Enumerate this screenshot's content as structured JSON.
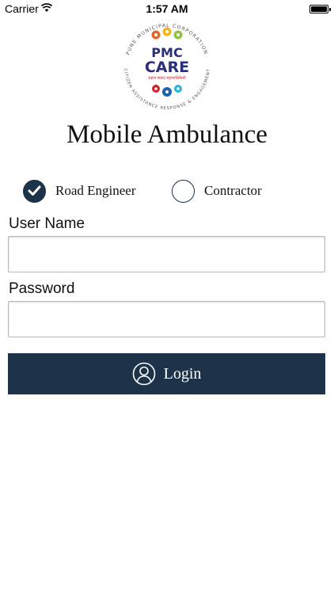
{
  "status_bar": {
    "carrier": "Carrier",
    "time": "1:57 AM"
  },
  "logo": {
    "line1": "PMC",
    "line2": "CARE",
    "tagline": "सहज संवाद महापालिकेशी",
    "ring_top": "PUNE MUNICIPAL CORPORATION",
    "ring_bottom": "CITIZEN ASSISTANCE RESPONSE & ENGAGEMENT"
  },
  "app_title": "Mobile Ambulance",
  "roles": [
    {
      "label": "Road Engineer",
      "selected": true
    },
    {
      "label": "Contractor",
      "selected": false
    }
  ],
  "form": {
    "username_label": "User Name",
    "username_value": "",
    "password_label": "Password",
    "password_value": ""
  },
  "login_button": {
    "label": "Login"
  },
  "colors": {
    "primary": "#1d3349",
    "logo_text": "#2a2f7a"
  }
}
